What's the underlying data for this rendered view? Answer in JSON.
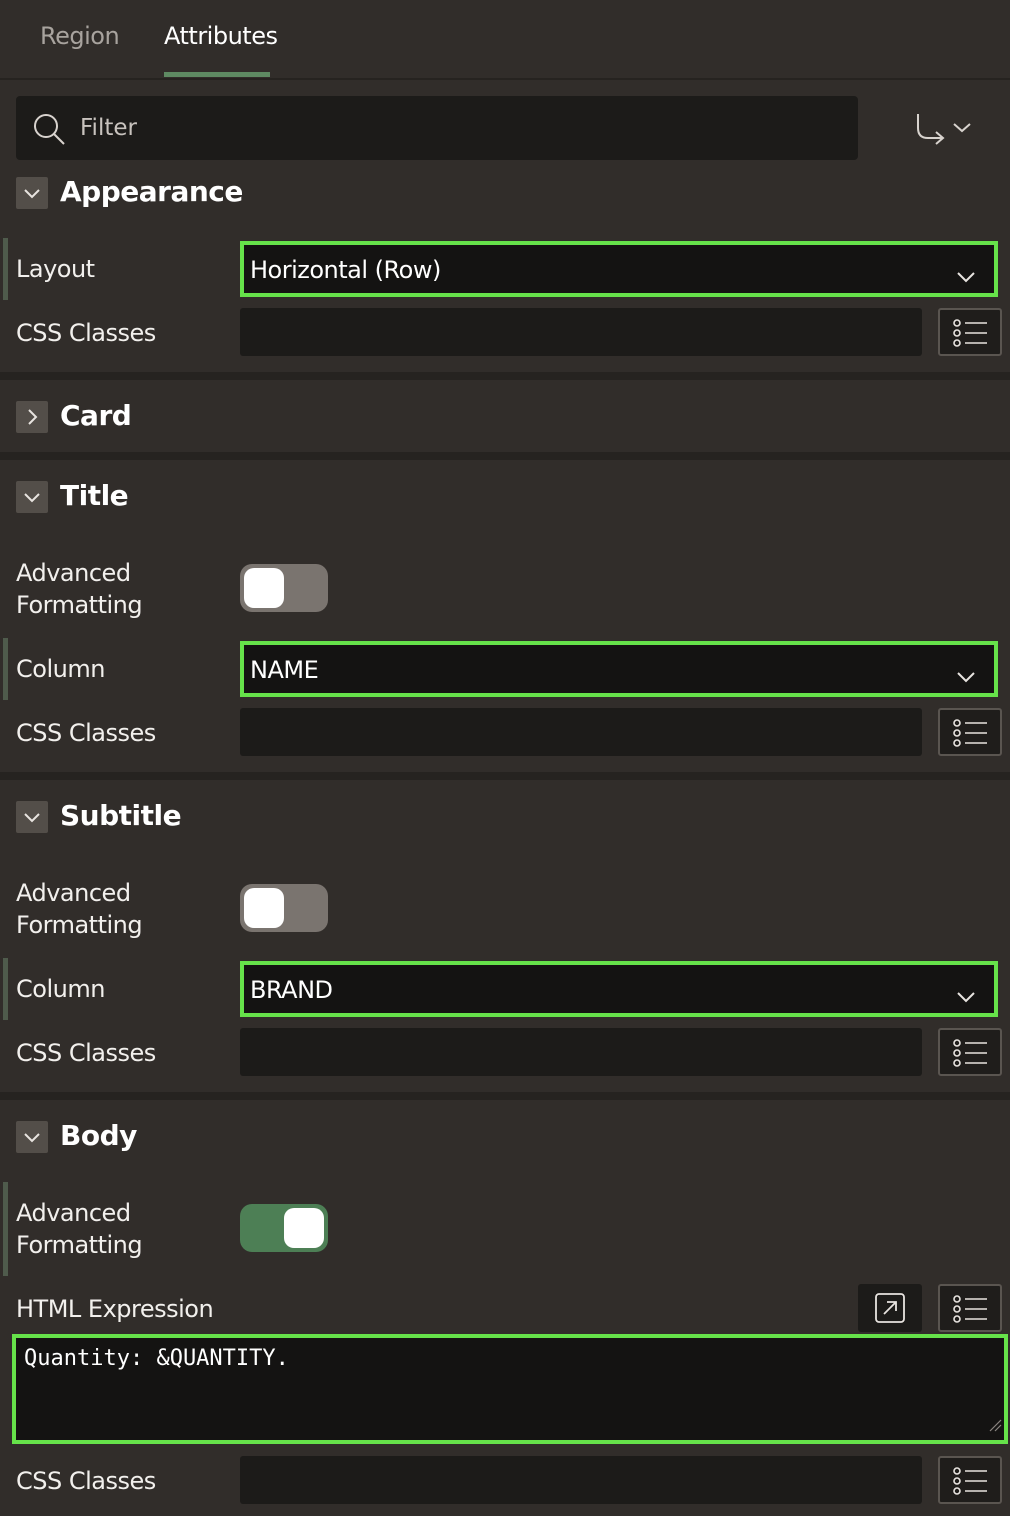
{
  "tabs": [
    {
      "label": "Region",
      "active": false
    },
    {
      "label": "Attributes",
      "active": true
    }
  ],
  "filter": {
    "placeholder": "Filter",
    "value": ""
  },
  "colors": {
    "accent_focus": "#66e24a",
    "toggle_on": "#4d7f55",
    "toggle_off": "#7a746f",
    "background": "#312d2a"
  },
  "sections": {
    "appearance": {
      "title": "Appearance",
      "expanded": true,
      "layout_label": "Layout",
      "layout_value": "Horizontal (Row)",
      "css_label": "CSS Classes",
      "css_value": ""
    },
    "card": {
      "title": "Card",
      "expanded": false
    },
    "title": {
      "title": "Title",
      "expanded": true,
      "adv_label_1": "Advanced",
      "adv_label_2": "Formatting",
      "advanced_formatting": false,
      "column_label": "Column",
      "column_value": "NAME",
      "css_label": "CSS Classes",
      "css_value": ""
    },
    "subtitle": {
      "title": "Subtitle",
      "expanded": true,
      "adv_label_1": "Advanced",
      "adv_label_2": "Formatting",
      "advanced_formatting": false,
      "column_label": "Column",
      "column_value": "BRAND",
      "css_label": "CSS Classes",
      "css_value": ""
    },
    "body": {
      "title": "Body",
      "expanded": true,
      "adv_label_1": "Advanced",
      "adv_label_2": "Formatting",
      "advanced_formatting": true,
      "html_label": "HTML Expression",
      "html_value": "Quantity: &QUANTITY.",
      "css_label": "CSS Classes",
      "css_value": ""
    }
  }
}
